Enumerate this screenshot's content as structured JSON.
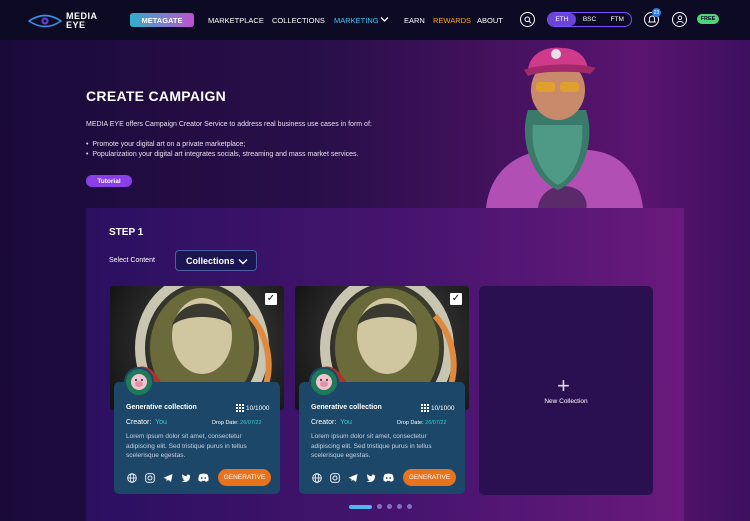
{
  "nav": {
    "logo_line1": "MEDIA",
    "logo_line2": "EYE",
    "metagate": "METAGATE",
    "links": [
      "MARKETPLACE",
      "COLLECTIONS",
      "MARKETING",
      "EARN",
      "REWARDS",
      "ABOUT"
    ],
    "chains": [
      "ETH",
      "BSC",
      "FTM"
    ],
    "notification_count": "23",
    "free_label": "FREE"
  },
  "hero": {
    "title": "CREATE CAMPAIGN",
    "description": "MEDIA EYE offers Campaign Creator Service to address real business use cases  in form of:",
    "bullets": [
      "Promote your digital art on a private marketplace;",
      "Popularization your digital art integrates socials, streaming and mass market services."
    ],
    "tutorial": "Tutorial"
  },
  "step": {
    "title": "STEP 1",
    "select_label": "Select Content",
    "dropdown_value": "Collections"
  },
  "cards": [
    {
      "title": "Generative collection",
      "count": "10/1000",
      "creator_label": "Creator:",
      "creator_value": "You",
      "drop_label": "Drop Date:",
      "drop_value": "26/07/22",
      "desc": "Lorem ipsum dolor sit amet, consectetur adipiscing elit. Sed tristique purus in tellus scelerisque egestas.",
      "button": "GENERATIVE",
      "checked": true
    },
    {
      "title": "Generative collection",
      "count": "10/1000",
      "creator_label": "Creator:",
      "creator_value": "You",
      "drop_label": "Drop Date:",
      "drop_value": "26/07/22",
      "desc": "Lorem ipsum dolor sit amet, consectetur adipiscing elit. Sed tristique purus in tellus scelerisque egestas.",
      "button": "GENERATIVE",
      "checked": true
    }
  ],
  "new_collection": "New Collection",
  "pagination": {
    "pages": 5,
    "active": 1
  },
  "colors": {
    "accent": "#e8731c",
    "teal": "#2fd0d0",
    "rewards": "#f5a623",
    "marketing": "#3ec7f5"
  }
}
